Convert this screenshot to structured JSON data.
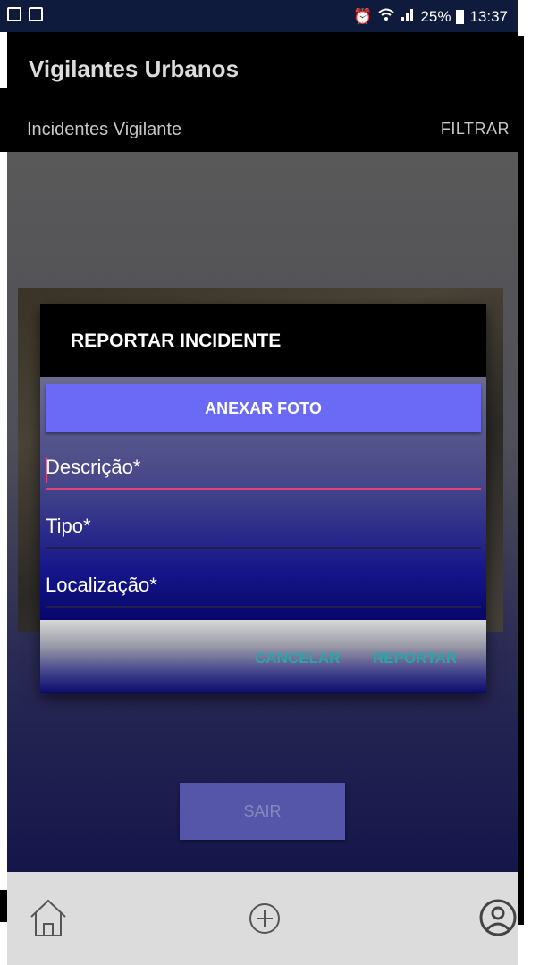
{
  "status_bar": {
    "battery": "25%",
    "time": "13:37"
  },
  "app_bar": {
    "title": "Vigilantes Urbanos",
    "subtitle": "Incidentes Vigilante",
    "filter_label": "FILTRAR"
  },
  "dialog": {
    "title": "REPORTAR INCIDENTE",
    "attach_label": "ANEXAR FOTO",
    "fields": {
      "description": "Descrição*",
      "type": "Tipo*",
      "location": "Localização*"
    },
    "cancel_label": "CANCELAR",
    "report_label": "REPORTAR"
  },
  "main": {
    "logout_label": "SAIR"
  },
  "bottom_nav": {
    "items": [
      {
        "icon": "home-icon"
      },
      {
        "icon": "add-circle-icon"
      },
      {
        "icon": "account-icon"
      }
    ]
  },
  "colors": {
    "accent": "#6a6af6",
    "focus_line": "#e0457a",
    "dialog_buttons": "#2aa6a8"
  }
}
